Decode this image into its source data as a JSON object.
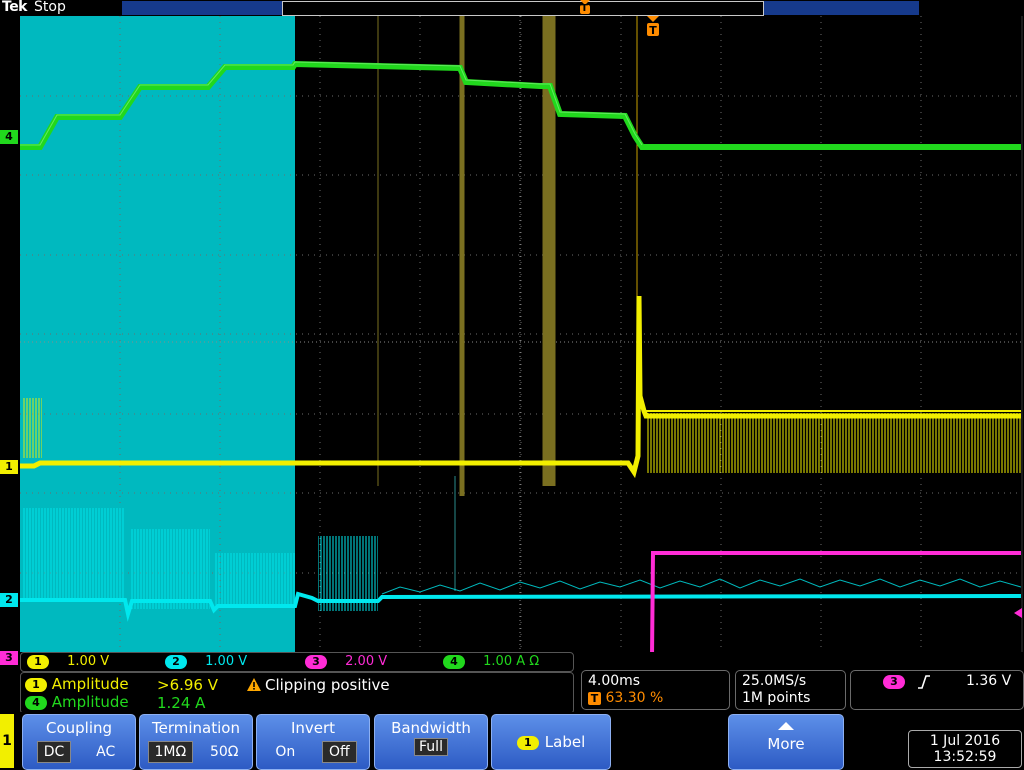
{
  "header": {
    "brand": "Tek",
    "acq_state": "Stop"
  },
  "colors": {
    "ch1": "#f2ef00",
    "ch2": "#00e8ee",
    "ch3": "#ff2cd6",
    "ch4": "#21d81d",
    "highlight_region": "#00b9bf",
    "trigger_marker": "#ff8c00",
    "menu_blue": "#3b6fd6"
  },
  "markers": {
    "trigger_top": "T",
    "ch1_ground": "1",
    "ch2_ground": "2",
    "ch3_ground": "3",
    "ch4_ground": "4"
  },
  "channels": [
    {
      "id": "1",
      "scale": "1.00 V"
    },
    {
      "id": "2",
      "scale": "1.00 V"
    },
    {
      "id": "3",
      "scale": "2.00 V"
    },
    {
      "id": "4",
      "scale": "1.00 A Ω"
    }
  ],
  "measurements": {
    "row1": {
      "source": "1",
      "label": "Amplitude",
      "value": ">6.96 V",
      "warning": "Clipping positive"
    },
    "row2": {
      "source": "4",
      "label": "Amplitude",
      "value": "1.24 A"
    }
  },
  "horizontal": {
    "scale": "4.00ms",
    "trigger_label": "T",
    "position": "63.30 %"
  },
  "acquisition": {
    "rate": "25.0MS/s",
    "record": "1M points"
  },
  "trigger": {
    "source": "3",
    "slope": "rising-edge-icon",
    "level": "1.36 V"
  },
  "menu": {
    "side_tab": "1",
    "coupling": {
      "title": "Coupling",
      "options": [
        "DC",
        "AC"
      ],
      "selected": "DC"
    },
    "termination": {
      "title": "Termination",
      "options": [
        "1MΩ",
        "50Ω"
      ],
      "selected": "1MΩ"
    },
    "invert": {
      "title": "Invert",
      "options": [
        "On",
        "Off"
      ],
      "selected": "Off"
    },
    "bandwidth": {
      "title": "Bandwidth",
      "value": "Full"
    },
    "label": {
      "chan": "1",
      "title": "Label"
    },
    "more": {
      "title": "More"
    }
  },
  "datetime": {
    "date": "1 Jul  2016",
    "time": "13:52:59"
  }
}
